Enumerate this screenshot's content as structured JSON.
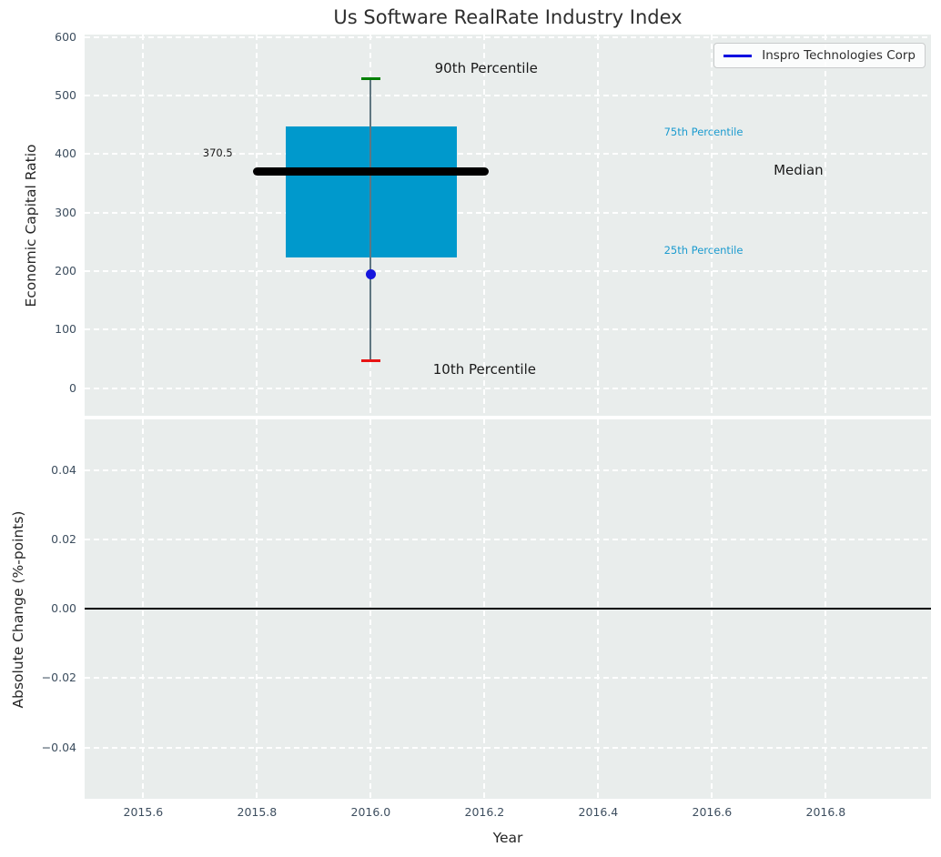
{
  "title": "Us Software RealRate Industry Index",
  "legend": {
    "label": "Inspro Technologies Corp"
  },
  "colors": {
    "axes_bg": "#e9edec",
    "grid": "#ffffff",
    "tick_label": "#3d4e5f",
    "text": "#262626",
    "box_fill": "#0099cc",
    "median_line": "#000000",
    "whisker": "#5f7680",
    "cap_90th": "#008000",
    "cap_10th": "#e81414",
    "company_marker": "#1616dd",
    "legend_line": "#0000e0",
    "percentile_label": "#1c9bcf",
    "zero_line": "#000000"
  },
  "chart_data": [
    {
      "type": "boxplot",
      "title": "Us Software RealRate Industry Index",
      "ylabel": "Economic Capital Ratio",
      "ylim": [
        -47,
        604
      ],
      "xlim": [
        2015.497,
        2016.985
      ],
      "grid": true,
      "yticks": [
        {
          "v": 0,
          "label": "0"
        },
        {
          "v": 100,
          "label": "100"
        },
        {
          "v": 200,
          "label": "200"
        },
        {
          "v": 300,
          "label": "300"
        },
        {
          "v": 400,
          "label": "400"
        },
        {
          "v": 500,
          "label": "500"
        },
        {
          "v": 600,
          "label": "600"
        }
      ],
      "xgrid": [
        2015.6,
        2015.8,
        2016.0,
        2016.2,
        2016.4,
        2016.6,
        2016.8
      ],
      "box": {
        "year": 2016.0,
        "p10": 48,
        "p25": 223,
        "median": 370.5,
        "p75": 447,
        "p90": 530,
        "company_value": 195,
        "box_left": 2015.851,
        "box_right": 2016.152,
        "median_left": 2015.793,
        "median_right": 2016.207,
        "cap_half_width": 0.017
      },
      "annotations": [
        {
          "text": "90th Percentile",
          "year": 2016.203,
          "value": 547,
          "size": 15,
          "color": "#1a1a1a"
        },
        {
          "text": "10th Percentile",
          "year": 2016.2,
          "value": 33,
          "size": 15,
          "color": "#1a1a1a"
        },
        {
          "text": "Median",
          "year": 2016.752,
          "value": 373,
          "size": 15,
          "color": "#1a1a1a"
        },
        {
          "text": "75th Percentile",
          "year": 2016.585,
          "value": 438,
          "size": 11.5,
          "color": "#1c9bcf"
        },
        {
          "text": "25th Percentile",
          "year": 2016.585,
          "value": 236,
          "size": 11.5,
          "color": "#1c9bcf"
        },
        {
          "text": "370.5",
          "year": 2015.731,
          "value": 402,
          "size": 11.5,
          "color": "#1a1a1a"
        }
      ],
      "legend_entries": [
        "Inspro Technologies Corp"
      ]
    },
    {
      "type": "line",
      "ylabel": "Absolute Change (%-points)",
      "xlabel": "Year",
      "ylim": [
        -0.0548,
        0.0546
      ],
      "xlim": [
        2015.497,
        2016.985
      ],
      "grid": true,
      "zero_line": 0.0,
      "yticks": [
        {
          "v": 0.04,
          "label": "0.04"
        },
        {
          "v": 0.02,
          "label": "0.02"
        },
        {
          "v": 0.0,
          "label": "0.00"
        },
        {
          "v": -0.02,
          "label": "−0.02"
        },
        {
          "v": -0.04,
          "label": "−0.04"
        }
      ],
      "xticks": [
        {
          "v": 2015.6,
          "label": "2015.6"
        },
        {
          "v": 2015.8,
          "label": "2015.8"
        },
        {
          "v": 2016.0,
          "label": "2016.0"
        },
        {
          "v": 2016.2,
          "label": "2016.2"
        },
        {
          "v": 2016.4,
          "label": "2016.4"
        },
        {
          "v": 2016.6,
          "label": "2016.6"
        },
        {
          "v": 2016.8,
          "label": "2016.8"
        }
      ],
      "series": [
        {
          "name": "Inspro Technologies Corp",
          "x": [],
          "y": []
        }
      ]
    }
  ]
}
